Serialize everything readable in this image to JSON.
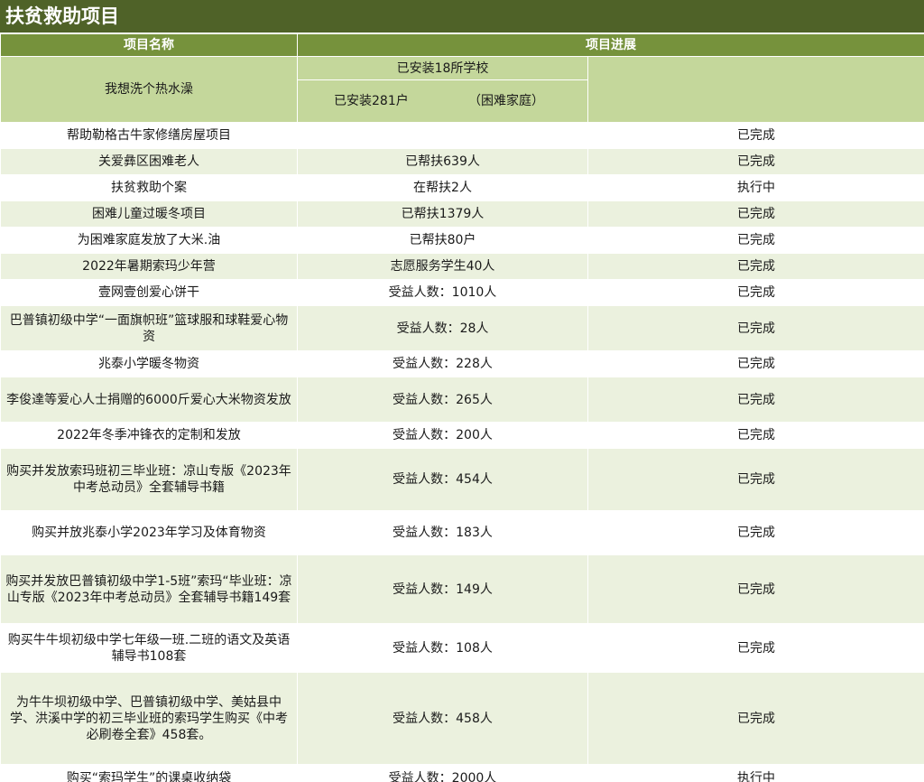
{
  "sheet_title": "扶贫救助项目",
  "columns": {
    "name": "项目名称",
    "progress": "项目进展"
  },
  "first_project": {
    "name": "我想洗个热水澡",
    "line1": "已安装18所学校",
    "line2_left": "已安装281户",
    "line2_right": "（困难家庭）"
  },
  "rows": [
    {
      "name": "帮助勒格古牛家修缮房屋项目",
      "detail": "",
      "status": "已完成"
    },
    {
      "name": "关爱彝区困难老人",
      "detail": "已帮扶639人",
      "status": "已完成"
    },
    {
      "name": "扶贫救助个案",
      "detail": "在帮扶2人",
      "status": "执行中"
    },
    {
      "name": "困难儿童过暖冬项目",
      "detail": "已帮扶1379人",
      "status": "已完成"
    },
    {
      "name": "为困难家庭发放了大米.油",
      "detail": "已帮扶80户",
      "status": "已完成"
    },
    {
      "name": "2022年暑期索玛少年营",
      "detail": "志愿服务学生40人",
      "status": "已完成"
    },
    {
      "name": "壹网壹创爱心饼干",
      "detail": "受益人数：1010人",
      "status": "已完成"
    },
    {
      "name": "巴普镇初级中学“一面旗帜班”篮球服和球鞋爱心物资",
      "detail": "受益人数：28人",
      "status": "已完成"
    },
    {
      "name": "兆泰小学暖冬物资",
      "detail": "受益人数：228人",
      "status": "已完成"
    },
    {
      "name": "李俊達等爱心人士捐赠的6000斤爱心大米物资发放",
      "detail": "受益人数：265人",
      "status": "已完成"
    },
    {
      "name": "2022年冬季冲锋衣的定制和发放",
      "detail": "受益人数：200人",
      "status": "已完成"
    },
    {
      "name": "购买并发放索玛班初三毕业班：凉山专版《2023年中考总动员》全套辅导书籍",
      "detail": "受益人数：454人",
      "status": "已完成"
    },
    {
      "name": "购买并放兆泰小学2023年学习及体育物资",
      "detail": "受益人数：183人",
      "status": "已完成"
    },
    {
      "name": "购买并发放巴普镇初级中学1-5班”索玛“毕业班：凉山专版《2023年中考总动员》全套辅导书籍149套",
      "detail": "受益人数：149人",
      "status": "已完成"
    },
    {
      "name": "购买牛牛坝初级中学七年级一班.二班的语文及英语辅导书108套",
      "detail": "受益人数：108人",
      "status": "已完成"
    },
    {
      "name": "为牛牛坝初级中学、巴普镇初级中学、美姑县中学、洪溪中学的初三毕业班的索玛学生购买《中考必刷卷全套》458套。",
      "detail": "受益人数：458人",
      "status": "已完成"
    },
    {
      "name": "购买“索玛学生”的课桌收纳袋",
      "detail": "受益人数：2000人",
      "status": "执行中"
    }
  ]
}
